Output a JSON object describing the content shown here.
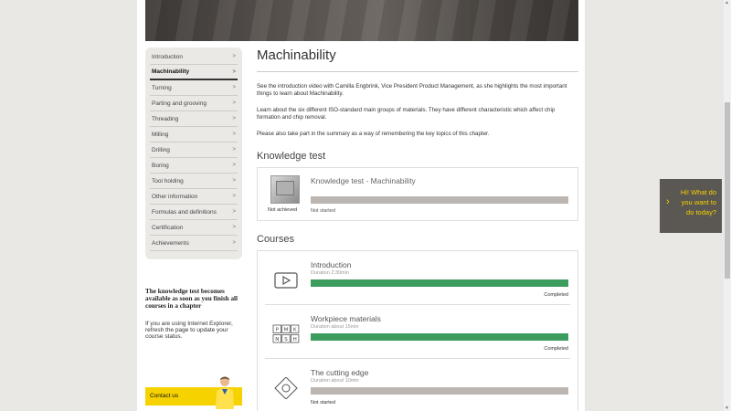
{
  "sidebar": {
    "items": [
      {
        "label": "Introduction",
        "active": false
      },
      {
        "label": "Machinability",
        "active": true
      },
      {
        "label": "Turning",
        "active": false
      },
      {
        "label": "Parting and grooving",
        "active": false
      },
      {
        "label": "Threading",
        "active": false
      },
      {
        "label": "Milling",
        "active": false
      },
      {
        "label": "Drilling",
        "active": false
      },
      {
        "label": "Boring",
        "active": false
      },
      {
        "label": "Tool holding",
        "active": false
      },
      {
        "label": "Other information",
        "active": false
      },
      {
        "label": "Formulas and definitions",
        "active": false
      },
      {
        "label": "Certification",
        "active": false
      },
      {
        "label": "Achievements",
        "active": false
      }
    ],
    "chevron": ">",
    "note_bold": "The knowledge test becomes available as soon as you finish all courses in a chapter",
    "note_plain": "If you are using Internet Explorer, refresh the page to update your course status.",
    "contact_label": "Contact us"
  },
  "main": {
    "title": "Machinability",
    "paragraphs": [
      "See the introduction video with Camilla Engbrink, Vice President Product Management, as she highlights the most important things to learn about Machinability.",
      "Learn about the six different ISO-standard main groups of materials. They have different characteristic which affect chip formation and chip removal.",
      "Please also take part in the summary as a way of remembering the key topics of this chapter."
    ],
    "knowledge_test": {
      "heading": "Knowledge test",
      "name": "Knowledge test - Machinability",
      "caption": "Not achieved",
      "status": "Not started",
      "progress": 0
    },
    "courses_heading": "Courses",
    "courses": [
      {
        "name": "Introduction",
        "duration": "Duration 2:30min",
        "status": "Completed",
        "progress": 1,
        "icon": "play-icon"
      },
      {
        "name": "Workpiece materials",
        "duration": "Duration about 15min",
        "status": "Completed",
        "progress": 1,
        "icon": "iso-materials-icon",
        "letters": [
          "P",
          "M",
          "K",
          "N",
          "S",
          "H"
        ]
      },
      {
        "name": "The cutting edge",
        "duration": "Duration about 10min",
        "status": "Not started",
        "progress": 0,
        "icon": "cutting-edge-icon"
      }
    ]
  },
  "help": {
    "arrow": "›",
    "text": "Hi! What do you want to do today?"
  },
  "colors": {
    "accent_yellow": "#f5d200",
    "progress_green": "#3d9d5e",
    "progress_bg": "#bbb6b1",
    "help_bg": "#5b5752"
  }
}
